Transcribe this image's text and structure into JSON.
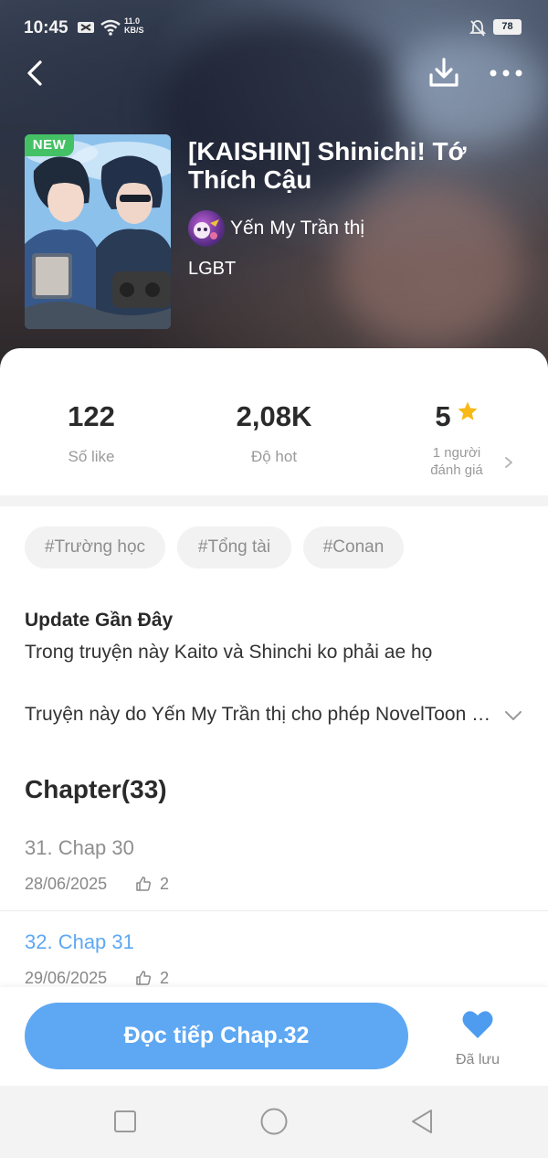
{
  "status_bar": {
    "time": "10:45",
    "network_speed_value": "11.0",
    "network_speed_unit": "KB/S",
    "battery": "78"
  },
  "book": {
    "new_badge": "NEW",
    "title": "[KAISHIN] Shinichi! Tớ Thích Cậu",
    "author": "Yến My Trần thị",
    "genre": "LGBT"
  },
  "stats": {
    "likes": {
      "value": "122",
      "label": "Số like"
    },
    "hot": {
      "value": "2,08K",
      "label": "Độ hot"
    },
    "rating": {
      "value": "5",
      "label_line1": "1 người",
      "label_line2": "đánh giá"
    }
  },
  "tags": [
    "#Trường học",
    "#Tổng tài",
    "#Conan"
  ],
  "update": {
    "title": "Update Gần Đây",
    "text": "Trong truyện này Kaito và Shinchi ko phải ae họ"
  },
  "description": "Truyện này do Yến My Trần thị cho phép NovelToon độc quyền phát hành",
  "chapters": {
    "heading": "Chapter(33)",
    "items": [
      {
        "title": "31. Chap 30",
        "date": "28/06/2025",
        "likes": "2",
        "state": "read"
      },
      {
        "title": "32. Chap 31",
        "date": "29/06/2025",
        "likes": "2",
        "state": "current"
      }
    ]
  },
  "actions": {
    "read_button": "Đọc tiếp Chap.32",
    "saved_label": "Đã lưu"
  },
  "colors": {
    "accent": "#5ea8f3",
    "new_badge": "#45c165",
    "star": "#f8b918",
    "heart": "#4e9cf0"
  },
  "icons": [
    "back-arrow-icon",
    "download-icon",
    "more-dots-icon",
    "star-icon",
    "chevron-right-icon",
    "chevron-down-icon",
    "thumbs-up-icon",
    "heart-icon",
    "recent-apps-icon",
    "home-icon",
    "back-icon"
  ]
}
